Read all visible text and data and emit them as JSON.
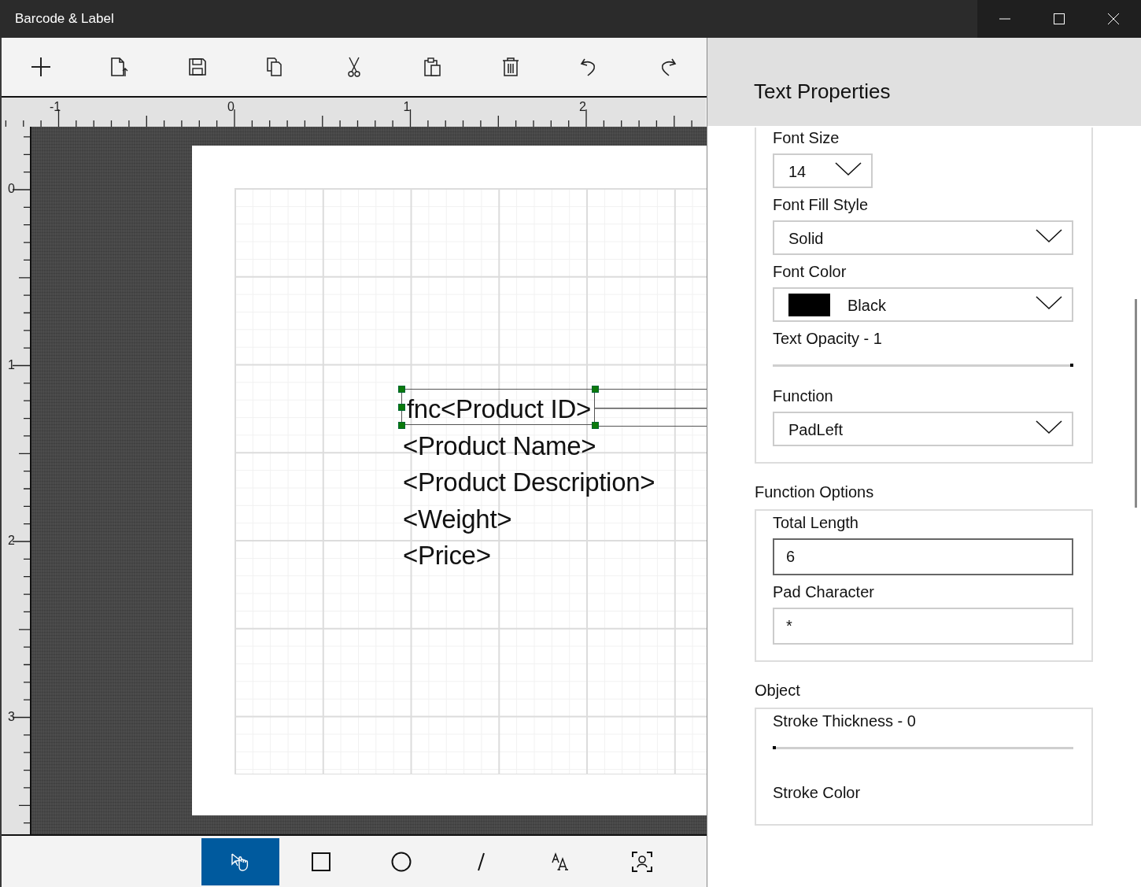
{
  "window": {
    "title": "Barcode & Label"
  },
  "rulers": {
    "horizontal": [
      "-1",
      "0",
      "1",
      "2"
    ],
    "vertical": [
      "0",
      "1",
      "2",
      "3"
    ]
  },
  "label_lines": [
    {
      "text": "fnc<Product ID>",
      "selected": true
    },
    {
      "text": "<Product Name>",
      "selected": false
    },
    {
      "text": "<Product Description>",
      "selected": false
    },
    {
      "text": "<Weight>",
      "selected": false
    },
    {
      "text": "<Price>",
      "selected": false
    }
  ],
  "tools": [
    {
      "kind": "pointer",
      "selected": true
    },
    {
      "kind": "rectangle",
      "selected": false
    },
    {
      "kind": "ellipse",
      "selected": false
    },
    {
      "kind": "line",
      "selected": false
    },
    {
      "kind": "text",
      "selected": false
    },
    {
      "kind": "select-area",
      "selected": false
    }
  ],
  "panel": {
    "title": "Text Properties",
    "groups": [
      {
        "fields": [
          {
            "kind": "small-dropdown",
            "label": "Font Size",
            "value": "14"
          },
          {
            "kind": "dropdown",
            "label": "Font Fill Style",
            "value": "Solid"
          },
          {
            "kind": "color-dropdown",
            "label": "Font Color",
            "value": "Black",
            "color": "#000000"
          },
          {
            "kind": "slider",
            "label": "Text Opacity - 1",
            "level": 1
          },
          {
            "kind": "dropdown",
            "label": "Function",
            "value": "PadLeft"
          }
        ]
      },
      {
        "heading": "Function Options",
        "fields": [
          {
            "kind": "input",
            "label": "Total Length",
            "value": "6",
            "focused": true
          },
          {
            "kind": "input",
            "label": "Pad Character",
            "value": "*",
            "focused": false
          }
        ]
      },
      {
        "heading": "Object",
        "fields": [
          {
            "kind": "slider",
            "label": "Stroke Thickness - 0",
            "level": 0
          },
          {
            "kind": "label",
            "label": "Stroke Color"
          }
        ]
      }
    ]
  }
}
